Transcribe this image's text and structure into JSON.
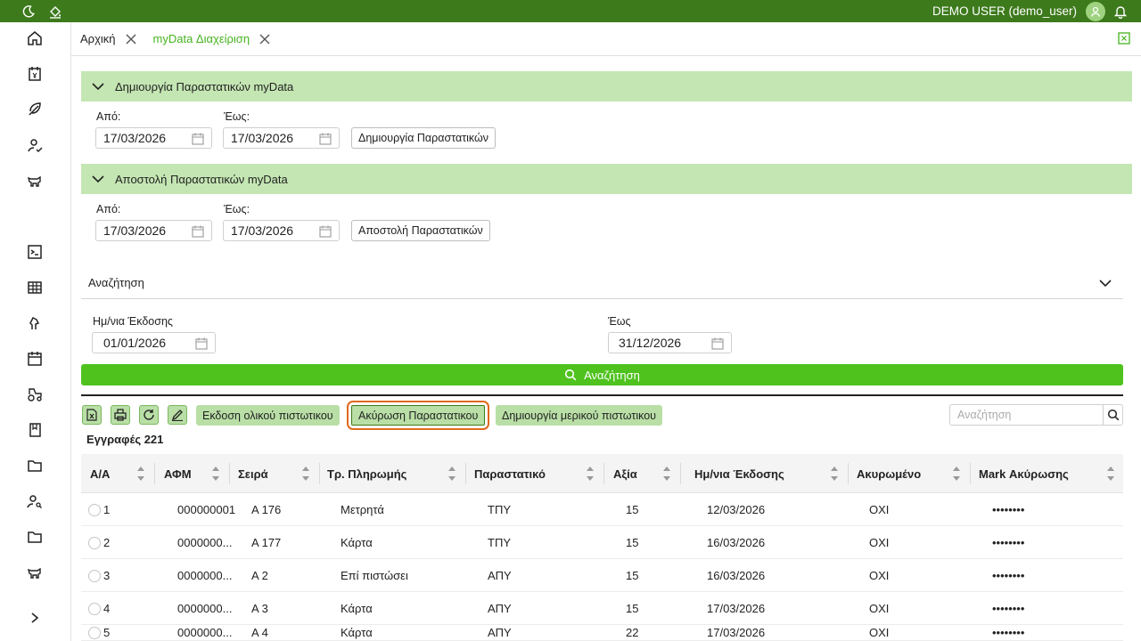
{
  "header": {
    "user": "DEMO USER (demo_user)"
  },
  "tabs": [
    {
      "label": "Αρχική",
      "active": false
    },
    {
      "label": "myData Διαχείριση",
      "active": true
    }
  ],
  "create_panel": {
    "title": "Δημιουργία Παραστατικών myData",
    "from_label": "Από:",
    "to_label": "Έως:",
    "from_value": "17/03/2026",
    "to_value": "17/03/2026",
    "button": "Δημιουργία Παραστατικών"
  },
  "send_panel": {
    "title": "Αποστολή Παραστατικών myData",
    "from_label": "Από:",
    "to_label": "Έως:",
    "from_value": "17/03/2026",
    "to_value": "17/03/2026",
    "button": "Αποστολή Παραστατικών"
  },
  "search_panel": {
    "title": "Αναζήτηση",
    "issue_date_label": "Ημ/νια Έκδοσης",
    "to_label": "Έως",
    "from_value": "01/01/2026",
    "to_value": "31/12/2026",
    "search_button": "Αναζήτηση"
  },
  "toolbar": {
    "full_credit": "Εκδοση ολικού πιστωτικου",
    "cancel_doc": "Ακύρωση Παραστατικου",
    "partial_credit": "Δημιουργία μερικού πιστωτικου",
    "search_placeholder": "Αναζήτηση"
  },
  "records_label": "Εγγραφές 221",
  "table": {
    "columns": [
      "Α/Α",
      "ΑΦΜ",
      "Σειρά",
      "Τρ. Πληρωμής",
      "Παραστατικό",
      "Αξία",
      "Ημ/νια Έκδοσης",
      "Ακυρωμένο",
      "Mark Ακύρωσης"
    ],
    "rows": [
      [
        "1",
        "000000001",
        "Α 176",
        "Μετρητά",
        "ΤΠΥ",
        "15",
        "12/03/2026",
        "ΟΧΙ",
        "••••••••"
      ],
      [
        "2",
        "0000000...",
        "Α 177",
        "Κάρτα",
        "ΤΠΥ",
        "15",
        "16/03/2026",
        "ΟΧΙ",
        "••••••••"
      ],
      [
        "3",
        "0000000...",
        "Α 2",
        "Επί πιστώσει",
        "ΑΠΥ",
        "15",
        "16/03/2026",
        "ΟΧΙ",
        "••••••••"
      ],
      [
        "4",
        "0000000...",
        "Α 3",
        "Κάρτα",
        "ΑΠΥ",
        "15",
        "17/03/2026",
        "ΟΧΙ",
        "••••••••"
      ],
      [
        "5",
        "0000000...",
        "Α 4",
        "Κάρτα",
        "ΑΠΥ",
        "22",
        "17/03/2026",
        "ΟΧΙ",
        "••••••••"
      ]
    ]
  },
  "colors": {
    "topbar": "#3d7a1c",
    "accent": "#4fc21e",
    "panel": "#c4e6b3",
    "focus": "#e06a1f"
  }
}
